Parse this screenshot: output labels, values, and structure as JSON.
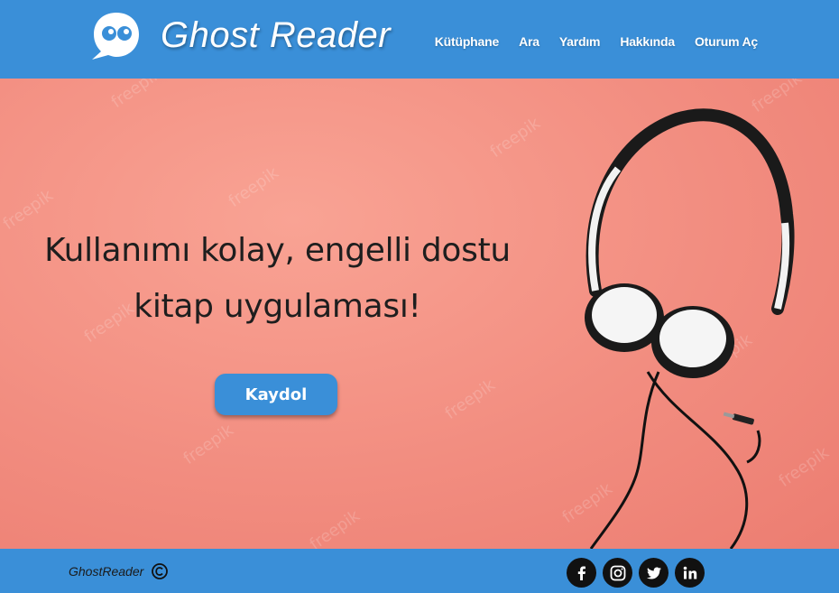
{
  "header": {
    "brand": "Ghost Reader",
    "logo_icon": "speech-bubble-eyes-icon",
    "nav": [
      {
        "label": "Kütüphane"
      },
      {
        "label": "Ara"
      },
      {
        "label": "Yardım"
      },
      {
        "label": "Hakkında"
      },
      {
        "label": "Oturum Aç"
      }
    ]
  },
  "hero": {
    "headline_line1": "Kullanımı kolay, engelli dostu",
    "headline_line2": "kitap uygulaması!",
    "signup_label": "Kaydol",
    "watermark_text": "freepik",
    "image_icon": "headphones-image"
  },
  "footer": {
    "brand": "GhostReader",
    "copyright_icon": "copyright-icon",
    "social": [
      {
        "icon": "facebook-icon"
      },
      {
        "icon": "instagram-icon"
      },
      {
        "icon": "twitter-icon"
      },
      {
        "icon": "linkedin-icon"
      }
    ]
  },
  "colors": {
    "primary": "#3a8fd8",
    "hero_bg": "#f4958a",
    "text_dark": "#1e1e1e"
  }
}
